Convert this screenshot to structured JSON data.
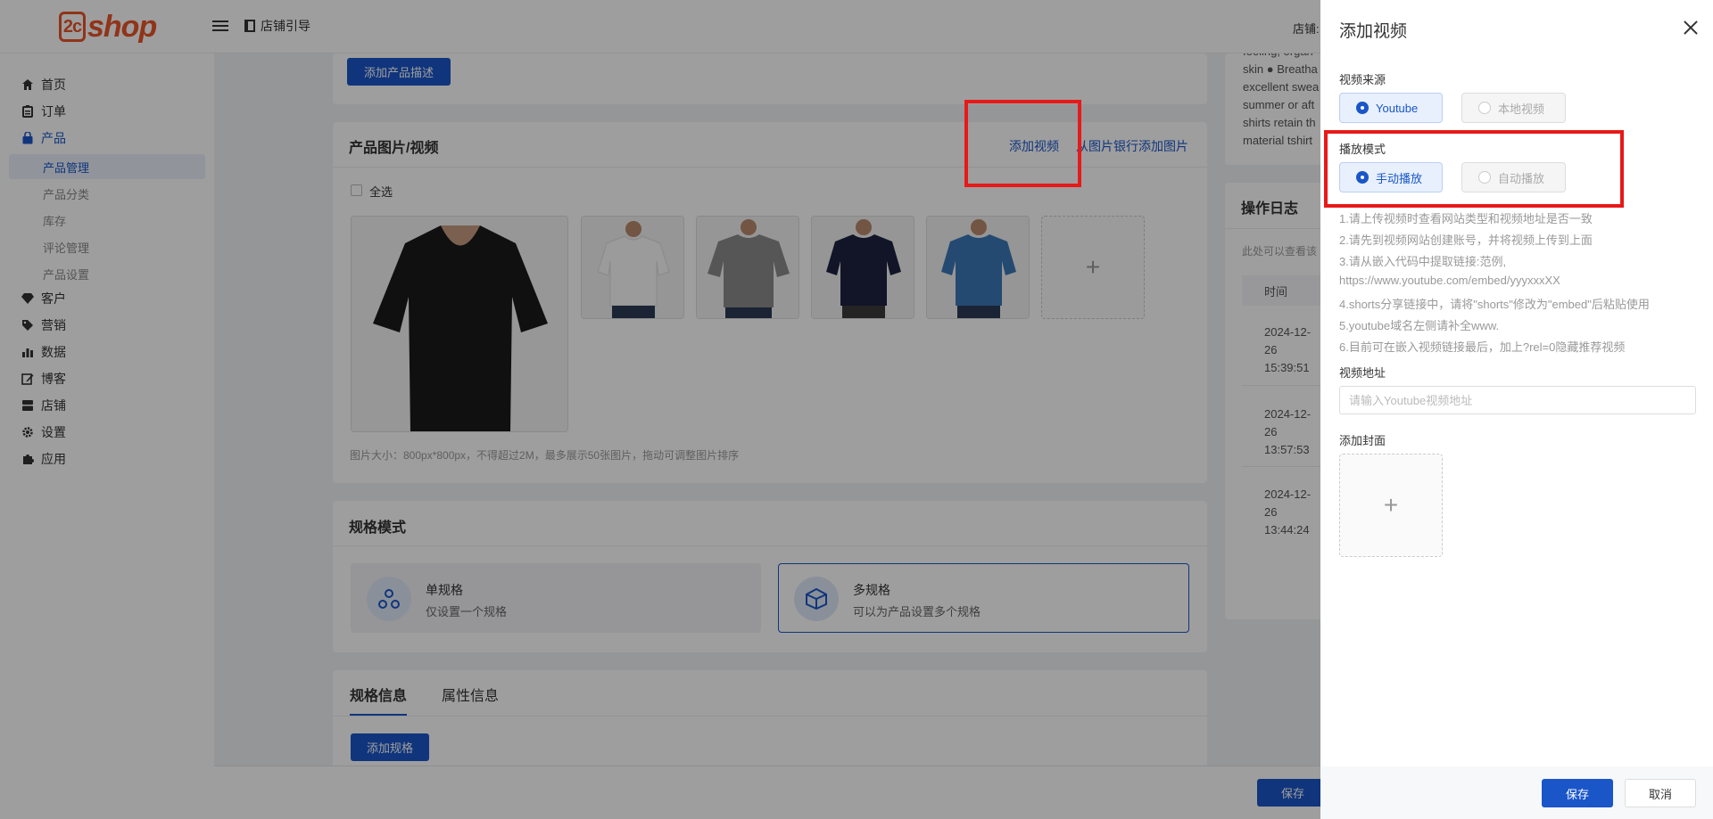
{
  "header": {
    "logo_mark": "2c",
    "logo_text": "shop",
    "guide_label": "店铺引导",
    "store_label": "店铺:"
  },
  "sidebar": {
    "items": [
      {
        "label": "首页",
        "icon": "home-icon"
      },
      {
        "label": "订单",
        "icon": "clipboard-icon"
      },
      {
        "label": "产品",
        "icon": "bag-icon"
      },
      {
        "label": "客户",
        "icon": "diamond-icon"
      },
      {
        "label": "营销",
        "icon": "tag-icon"
      },
      {
        "label": "数据",
        "icon": "bar-chart-icon"
      },
      {
        "label": "博客",
        "icon": "edit-icon"
      },
      {
        "label": "店铺",
        "icon": "store-icon"
      },
      {
        "label": "设置",
        "icon": "gear-icon"
      },
      {
        "label": "应用",
        "icon": "puzzle-icon"
      }
    ],
    "product_sub": [
      "产品管理",
      "产品分类",
      "库存",
      "评论管理",
      "产品设置"
    ]
  },
  "main": {
    "add_desc_button": "添加产品描述",
    "media": {
      "title": "产品图片/视频",
      "add_video_link": "添加视频",
      "bank_link": "从图片银行添加图片",
      "select_all": "全选",
      "hint": "图片大小：800px*800px，不得超过2M，最多展示50张图片，拖动可调整图片排序"
    },
    "spec": {
      "title": "规格模式",
      "single_name": "单规格",
      "single_desc": "仅设置一个规格",
      "multi_name": "多规格",
      "multi_desc": "可以为产品设置多个规格"
    },
    "tabs": [
      "规格信息",
      "属性信息"
    ],
    "add_spec_button": "添加规格",
    "save_button": "保存"
  },
  "right_panel": {
    "desc_lines": [
      "feeling, organ",
      "skin ● Breatha",
      "excellent swea",
      "summer or aft",
      "shirts retain th",
      "material tshirt"
    ],
    "log_title": "操作日志",
    "log_hint": "此处可以查看该",
    "time_header": "时间",
    "log_entries": [
      [
        "2024-12-",
        "26",
        "15:39:51"
      ],
      [
        "2024-12-",
        "26",
        "13:57:53"
      ],
      [
        "2024-12-",
        "26",
        "13:44:24"
      ]
    ]
  },
  "drawer": {
    "title": "添加视频",
    "source_label": "视频来源",
    "source_options": [
      "Youtube",
      "本地视频"
    ],
    "play_label": "播放模式",
    "play_options": [
      "手动播放",
      "自动播放"
    ],
    "instructions": [
      "1.请上传视频时查看网站类型和视频地址是否一致",
      "2.请先到视频网站创建账号，并将视频上传到上面",
      "3.请从嵌入代码中提取链接:范例,",
      "https://www.youtube.com/embed/yyyxxxXX",
      "4.shorts分享链接中，请将\"shorts\"修改为\"embed\"后粘贴使用",
      "5.youtube域名左侧请补全www.",
      "6.目前可在嵌入视频链接最后，加上?rel=0隐藏推荐视频"
    ],
    "url_label": "视频地址",
    "url_placeholder": "请输入Youtube视频地址",
    "url_value": "",
    "cover_label": "添加封面",
    "save_button": "保存",
    "cancel_button": "取消"
  },
  "colors": {
    "primary": "#1a56c8",
    "brand": "#e8552a",
    "highlight": "#e81919"
  }
}
